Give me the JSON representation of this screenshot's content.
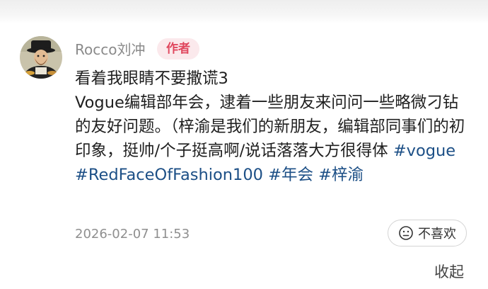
{
  "comment": {
    "username": "Rocco刘冲",
    "author_badge": "作者",
    "text_line1": "看着我眼睛不要撒谎3",
    "text_body": "Vogue编辑部年会，逮着一些朋友来问问一些略微刁钻的友好问题。（梓渝是我们的新朋友，编辑部同事们的初印象，挺帅/个子挺高啊/说话落落大方很得体",
    "hashtags": [
      "#vogue",
      "#RedFaceOfFashion100",
      "#年会",
      "#梓渝"
    ],
    "timestamp": "2026-02-07 11:53",
    "dislike_label": "不喜欢",
    "dislike_icon": "neutral-face-icon"
  },
  "footer": {
    "collapse_label": "收起"
  },
  "colors": {
    "hashtag": "#1c4f86",
    "badge_text": "#e0475e",
    "badge_bg": "#fbe9ec",
    "meta_gray": "#8f8f8f"
  }
}
